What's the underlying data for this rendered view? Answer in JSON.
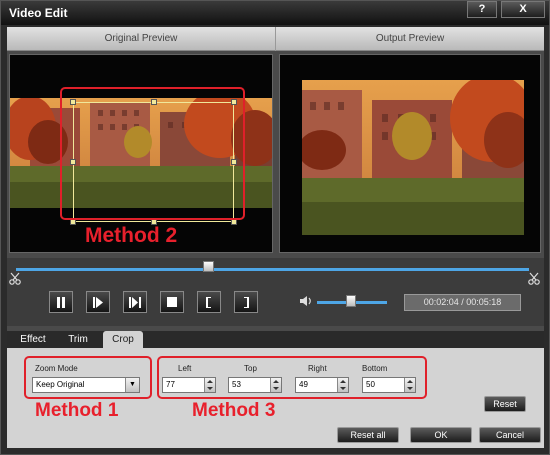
{
  "window": {
    "title": "Video Edit",
    "help_label": "?",
    "close_label": "X"
  },
  "preview": {
    "original_label": "Original Preview",
    "output_label": "Output Preview"
  },
  "annotations": {
    "method2": "Method 2",
    "method1": "Method 1",
    "method3": "Method 3",
    "color": "#e0202a"
  },
  "playback": {
    "progress": 0.38,
    "volume": 0.45,
    "time_current": "00:02:04",
    "time_separator": "/",
    "time_total": "00:05:18",
    "time_display": "00:02:04 / 00:05:18",
    "buttons": [
      {
        "name": "pause-button",
        "icon": "pause-icon"
      },
      {
        "name": "play-button",
        "icon": "play-icon"
      },
      {
        "name": "next-frame-button",
        "icon": "step-forward-icon"
      },
      {
        "name": "stop-button",
        "icon": "stop-icon"
      },
      {
        "name": "set-start-button",
        "icon": "bracket-left-icon"
      },
      {
        "name": "set-end-button",
        "icon": "bracket-right-icon"
      }
    ]
  },
  "tabs": [
    {
      "label": "Effect",
      "active": false
    },
    {
      "label": "Trim",
      "active": false
    },
    {
      "label": "Crop",
      "active": true
    }
  ],
  "crop": {
    "zoom_mode_label": "Zoom Mode",
    "zoom_mode_value": "Keep Original",
    "left_label": "Left",
    "left_value": "77",
    "top_label": "Top",
    "top_value": "53",
    "right_label": "Right",
    "right_value": "49",
    "bottom_label": "Bottom",
    "bottom_value": "50",
    "reset_label": "Reset"
  },
  "footer": {
    "reset_all_label": "Reset all",
    "ok_label": "OK",
    "cancel_label": "Cancel"
  },
  "colors": {
    "accent": "#4ea6e6",
    "crop_frame": "#f0e89a",
    "panel_bg": "#d3d3d3"
  }
}
